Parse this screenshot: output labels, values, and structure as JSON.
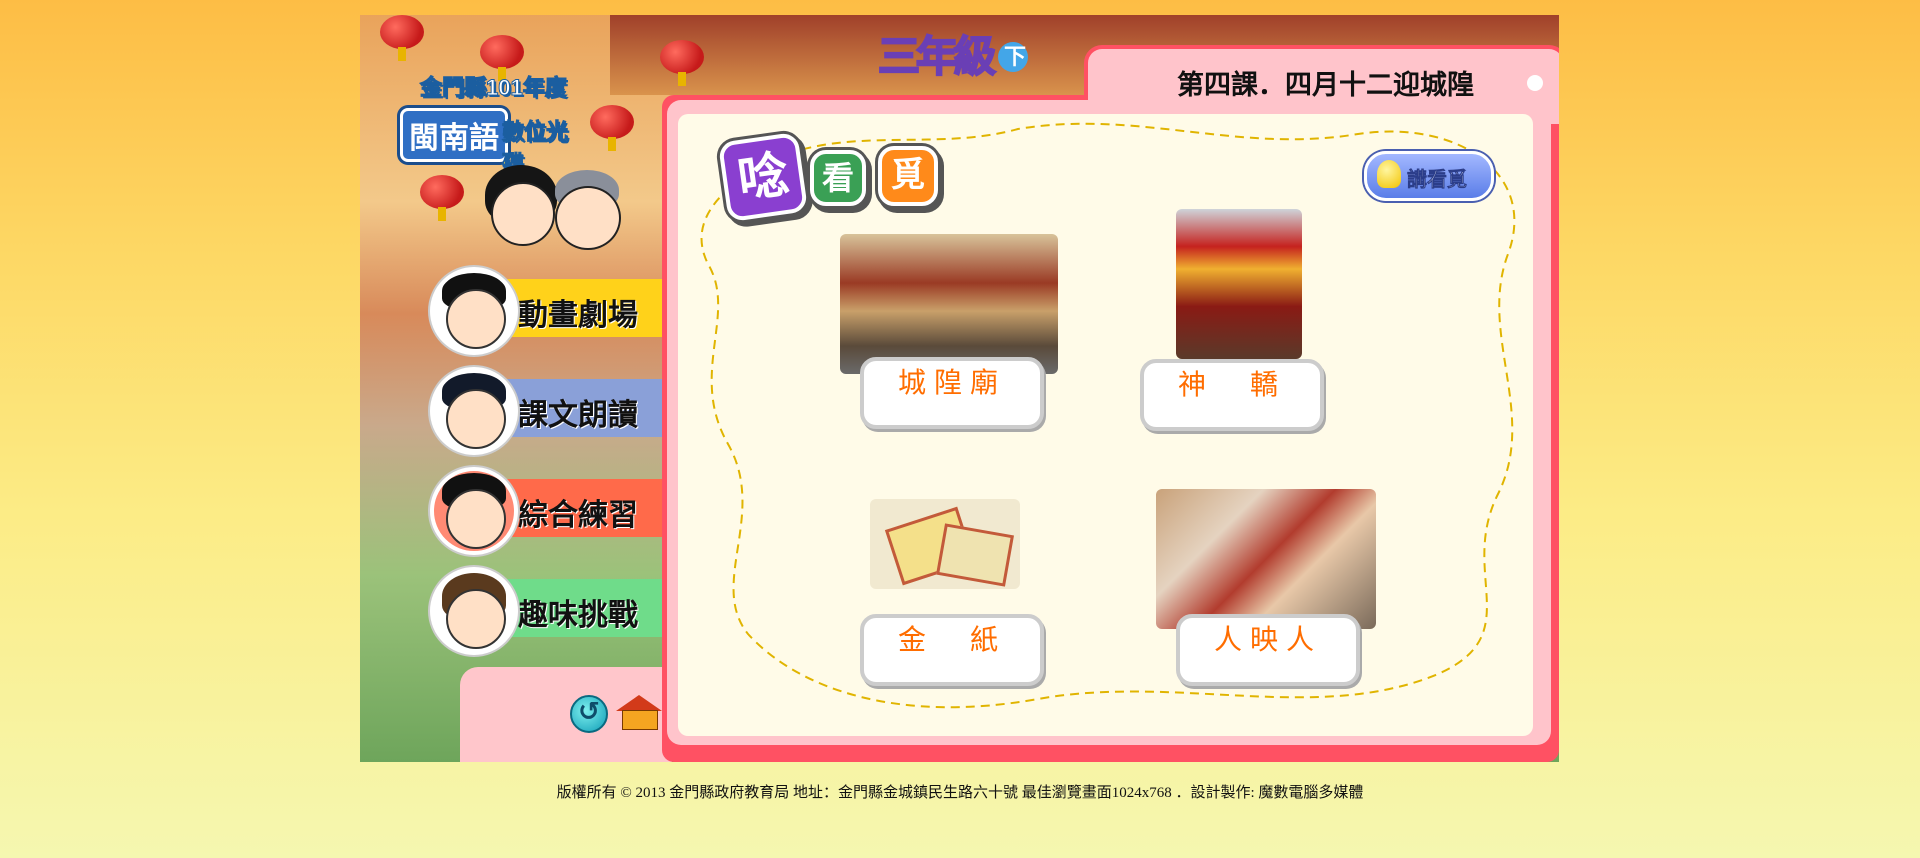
{
  "app": {
    "logo_line1": "金門縣101年度",
    "logo_line2": "閩南語",
    "logo_line3": "數位光碟",
    "grade": "三年級",
    "grade_badge": "下",
    "lesson_title": "第四課．四月十二迎城隍"
  },
  "menu": {
    "items": [
      {
        "label": "動畫劇場",
        "color": "#ffd21a",
        "hair": "#111111"
      },
      {
        "label": "課文朗讀",
        "color": "#8aa0d8",
        "hair": "#121a2a"
      },
      {
        "label": "綜合練習",
        "color": "#ff6a4a",
        "hair": "#111111"
      },
      {
        "label": "趣味挑戰",
        "color": "#6fdc8a",
        "hair": "#5a3a1e"
      }
    ]
  },
  "nav": {
    "back_icon": "refresh-icon",
    "home_icon": "home-icon"
  },
  "content": {
    "heading_chars": [
      "唸",
      "看",
      "覓"
    ],
    "heading_colors": [
      "#8a3fd0",
      "#3aa055",
      "#ff8a1a"
    ],
    "speak_button": "講看覓",
    "items": [
      {
        "label": "城隍廟",
        "image": "temple-photo"
      },
      {
        "label": "神　轎",
        "image": "sedan-chair-photo"
      },
      {
        "label": "金　紙",
        "image": "joss-paper-illustration"
      },
      {
        "label": "人映人",
        "image": "crowd-illustration"
      }
    ]
  },
  "footer": {
    "text": "版權所有 © 2013  金門縣政府教育局  地址：金門縣金城鎮民生路六十號  最佳瀏覽畫面1024x768  ．設計製作: 魔數電腦多媒體"
  }
}
